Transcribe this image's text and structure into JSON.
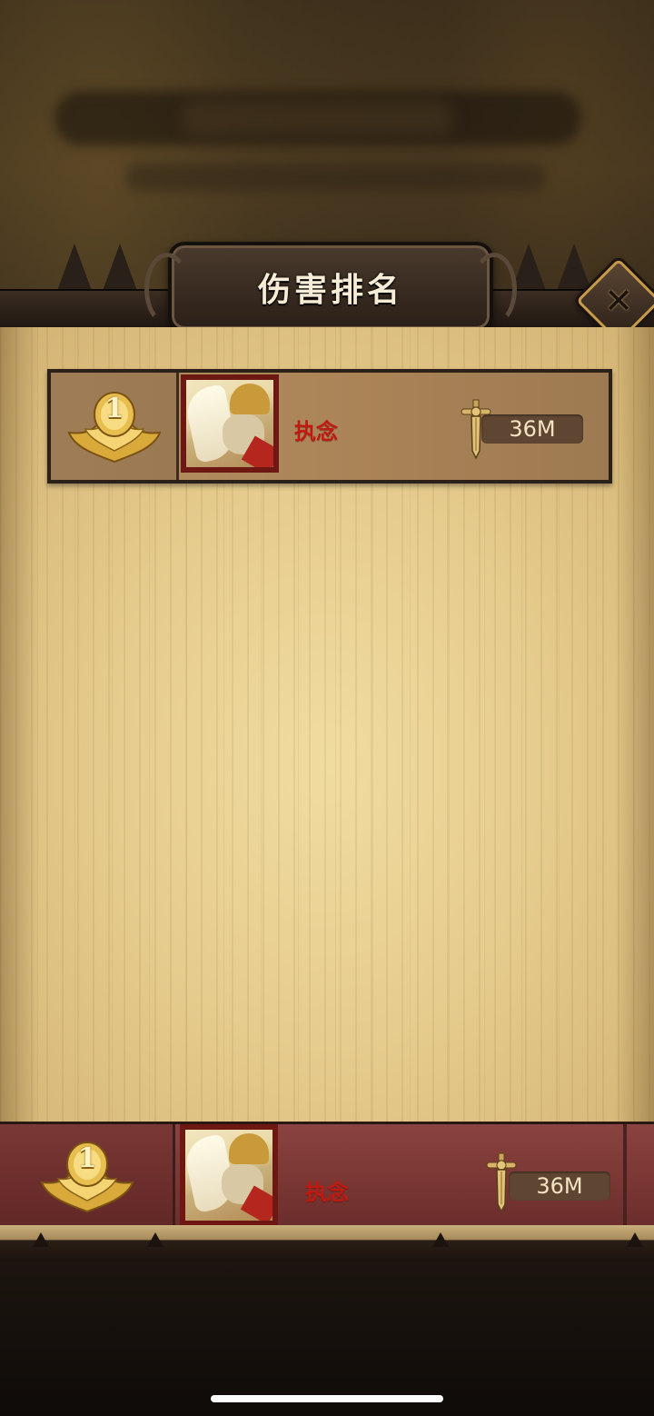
{
  "dialog": {
    "title": "伤害排名",
    "close_icon": "close-icon"
  },
  "rankings": [
    {
      "rank": "1",
      "player_name": "执念",
      "damage": "36M"
    }
  ],
  "my_rank": {
    "rank": "1",
    "player_name": "执念",
    "damage": "36M"
  },
  "colors": {
    "parchment": "#e6cc8e",
    "name_red": "#c01a10",
    "my_rank_bar": "#7a3734",
    "gold": "#d9a93a"
  }
}
